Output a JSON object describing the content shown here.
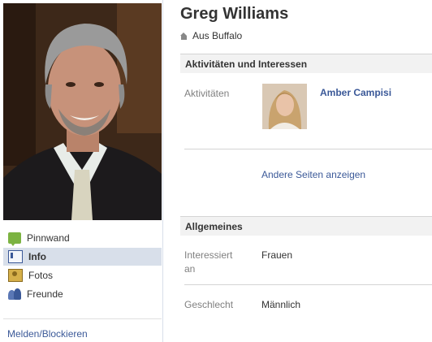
{
  "profile": {
    "name": "Greg Williams",
    "location": "Aus Buffalo"
  },
  "nav": {
    "items": [
      {
        "label": "Pinnwand",
        "icon": "wall-icon"
      },
      {
        "label": "Info",
        "icon": "info-icon",
        "active": true
      },
      {
        "label": "Fotos",
        "icon": "photos-icon"
      },
      {
        "label": "Freunde",
        "icon": "friends-icon"
      }
    ],
    "report_label": "Melden/Blockieren"
  },
  "activities": {
    "header": "Aktivitäten und Interessen",
    "label": "Aktivitäten",
    "entry_name": "Amber Campisi",
    "more_link": "Andere Seiten anzeigen"
  },
  "general": {
    "header": "Allgemeines",
    "interested_label_line1": "Interessiert",
    "interested_label_line2": "an",
    "interested_value": "Frauen",
    "gender_label": "Geschlecht",
    "gender_value": "Männlich"
  },
  "colors": {
    "link": "#3b5998",
    "nav_active_bg": "#d8dfea",
    "section_header_bg": "#f2f2f2"
  }
}
